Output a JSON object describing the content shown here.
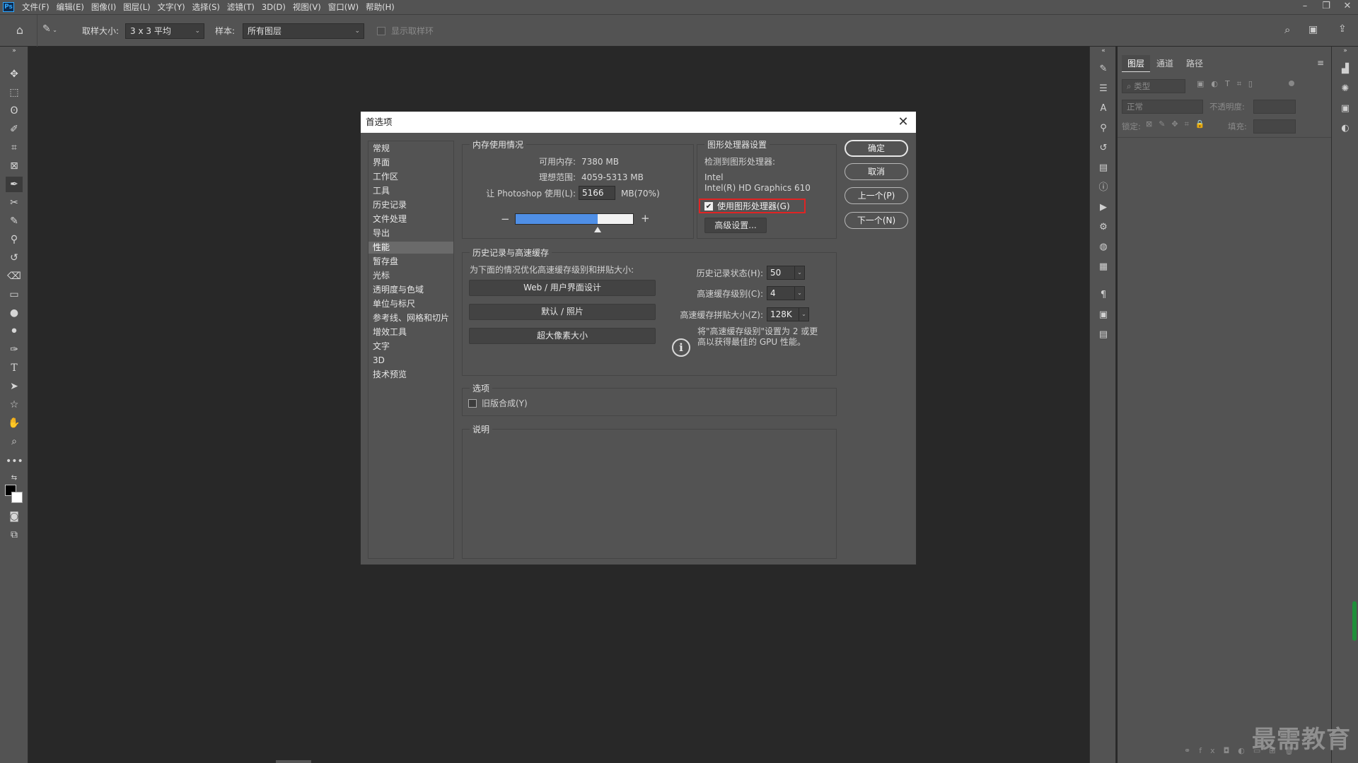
{
  "app": {
    "logo": "Ps",
    "menus": [
      "文件(F)",
      "编辑(E)",
      "图像(I)",
      "图层(L)",
      "文字(Y)",
      "选择(S)",
      "滤镜(T)",
      "3D(D)",
      "视图(V)",
      "窗口(W)",
      "帮助(H)"
    ]
  },
  "options": {
    "sample_size_label": "取样大小:",
    "sample_size_value": "3 x 3 平均",
    "sample_label": "样本:",
    "sample_value": "所有图层",
    "show_ring_label": "显示取样环"
  },
  "layers_panel": {
    "tabs": [
      "图层",
      "通道",
      "路径"
    ],
    "filter_placeholder": "类型",
    "blend_mode": "正常",
    "opacity_label": "不透明度:",
    "lock_label": "锁定:",
    "fill_label": "填充:"
  },
  "watermark": "最需教育",
  "dialog": {
    "title": "首选项",
    "nav": [
      "常规",
      "界面",
      "工作区",
      "工具",
      "历史记录",
      "文件处理",
      "导出",
      "性能",
      "暂存盘",
      "光标",
      "透明度与色域",
      "单位与标尺",
      "参考线、网格和切片",
      "增效工具",
      "文字",
      "3D",
      "技术预览"
    ],
    "selected_index": 7,
    "memory": {
      "title": "内存使用情况",
      "available_label": "可用内存:",
      "available_value": "7380 MB",
      "ideal_label": "理想范围:",
      "ideal_value": "4059-5313 MB",
      "use_label": "让 Photoshop 使用(L):",
      "use_value": "5166",
      "use_unit": "MB(70%)",
      "slider_fraction": 0.7,
      "minus": "−",
      "plus": "+"
    },
    "gpu": {
      "title": "图形处理器设置",
      "detected_label": "检测到图形处理器:",
      "vendor": "Intel",
      "model": "Intel(R) HD Graphics 610",
      "use_gpu_label": "使用图形处理器(G)",
      "use_gpu_checked": true,
      "advanced_button": "高级设置..."
    },
    "history": {
      "title": "历史记录与高速缓存",
      "optimize_label": "为下面的情况优化高速缓存级别和拼贴大小:",
      "preset_buttons": [
        "Web / 用户界面设计",
        "默认 / 照片",
        "超大像素大小"
      ],
      "states_label": "历史记录状态(H):",
      "states_value": "50",
      "levels_label": "高速缓存级别(C):",
      "levels_value": "4",
      "tile_label": "高速缓存拼贴大小(Z):",
      "tile_value": "128K",
      "tip": "将\"高速缓存级别\"设置为 2 或更高以获得最佳的 GPU 性能。"
    },
    "options": {
      "title": "选项",
      "legacy_label": "旧版合成(Y)",
      "legacy_checked": false
    },
    "description": {
      "title": "说明"
    },
    "buttons": {
      "ok": "确定",
      "cancel": "取消",
      "prev": "上一个(P)",
      "next": "下一个(N)"
    }
  },
  "colors": {
    "highlight": "#e02424",
    "slider_fill": "#4f8fe6"
  }
}
